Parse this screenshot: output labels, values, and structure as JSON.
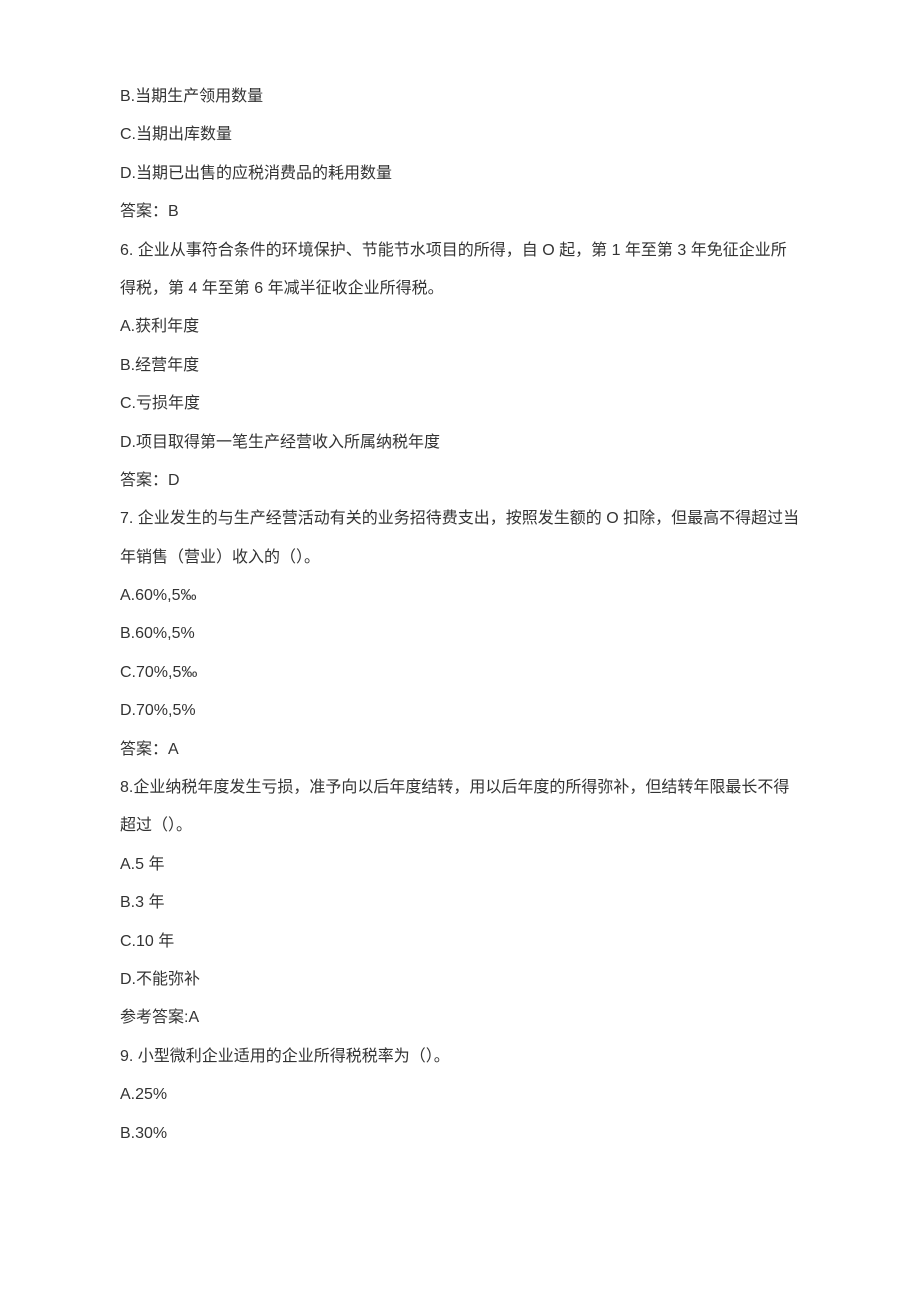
{
  "lines": [
    "B.当期生产领用数量",
    "C.当期出库数量",
    "D.当期已出售的应税消费品的耗用数量",
    "答案：B",
    "6. 企业从事符合条件的环境保护、节能节水项目的所得，自 O 起，第 1 年至第 3 年免征企业所得税，第 4 年至第 6 年减半征收企业所得税。",
    "A.获利年度",
    "B.经营年度",
    "C.亏损年度",
    "D.项目取得第一笔生产经营收入所属纳税年度",
    "答案：D",
    "7. 企业发生的与生产经营活动有关的业务招待费支出，按照发生额的 O 扣除，但最高不得超过当年销售（营业）收入的（）。",
    "A.60%,5‰",
    "B.60%,5%",
    "C.70%,5‰",
    "D.70%,5%",
    "答案：A",
    "8.企业纳税年度发生亏损，准予向以后年度结转，用以后年度的所得弥补，但结转年限最长不得超过（）。",
    "A.5 年",
    "B.3 年",
    "C.10 年",
    "D.不能弥补",
    "参考答案:A",
    "9. 小型微利企业适用的企业所得税税率为（）。",
    "A.25%",
    "B.30%"
  ]
}
